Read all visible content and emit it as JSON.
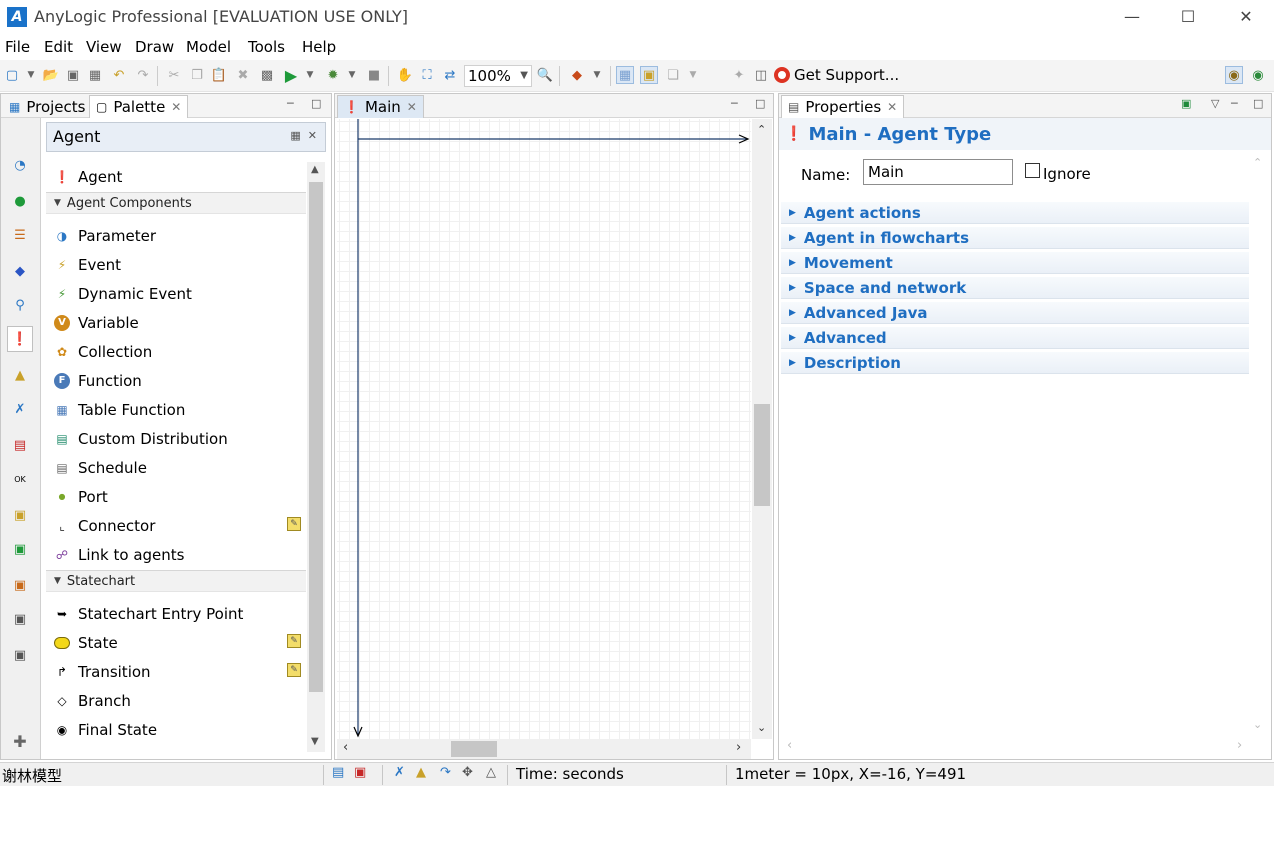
{
  "window": {
    "title": "AnyLogic Professional [EVALUATION USE ONLY]",
    "logo": "anylogic-logo"
  },
  "menu": [
    "File",
    "Edit",
    "View",
    "Draw",
    "Model",
    "Tools",
    "Help"
  ],
  "toolbar": {
    "zoom": "100%",
    "support_label": "Get Support..."
  },
  "left_panel": {
    "tabs": [
      {
        "label": "Projects"
      },
      {
        "label": "Palette"
      }
    ],
    "palette_header": "Agent",
    "top_item": "Agent",
    "sections": [
      {
        "title": "Agent Components",
        "items": [
          "Parameter",
          "Event",
          "Dynamic Event",
          "Variable",
          "Collection",
          "Function",
          "Table Function",
          "Custom Distribution",
          "Schedule",
          "Port",
          "Connector",
          "Link to agents"
        ]
      },
      {
        "title": "Statechart",
        "items": [
          "Statechart Entry Point",
          "State",
          "Transition",
          "Branch",
          "Final State"
        ]
      }
    ]
  },
  "editor": {
    "tab_label": "Main"
  },
  "properties": {
    "tab_label": "Properties",
    "title": "Main - Agent Type",
    "name_label": "Name:",
    "name_value": "Main",
    "ignore_label": "Ignore",
    "ignore_checked": false,
    "sections": [
      "Agent actions",
      "Agent in flowcharts",
      "Movement",
      "Space and network",
      "Advanced Java",
      "Advanced",
      "Description"
    ]
  },
  "statusbar": {
    "project": "谢林模型",
    "time_units": "Time: seconds",
    "coords": "1meter = 10px, X=-16, Y=491"
  },
  "colors": {
    "accent": "#1f6ec1",
    "agent_red": "#c62828"
  }
}
